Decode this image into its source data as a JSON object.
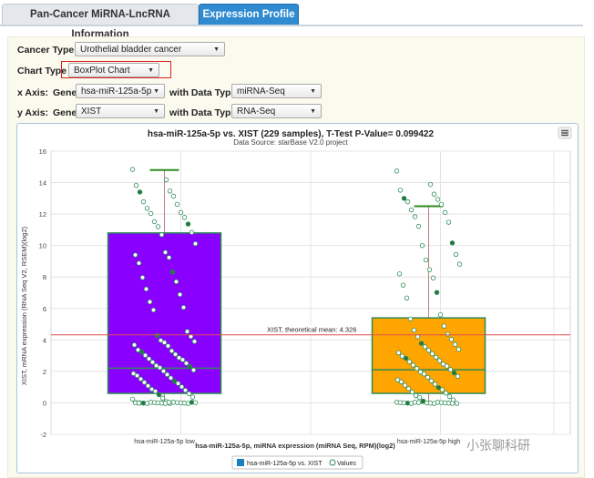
{
  "tabs": [
    {
      "label": "Pan-Cancer MiRNA-LncRNA Information"
    },
    {
      "label": "Expression Profile"
    }
  ],
  "form": {
    "cancer_type_label": "Cancer Type",
    "cancer_type_value": "Urothelial bladder cancer",
    "chart_type_label": "Chart Type",
    "chart_type_value": "BoxPlot Chart",
    "x_axis_label": "x Axis:",
    "y_axis_label": "y Axis:",
    "gene_label": "Gene",
    "with_data_type_label": "with Data Type",
    "x_gene_value": "hsa-miR-125a-5p",
    "x_data_type_value": "miRNA-Seq",
    "y_gene_value": "XIST",
    "y_data_type_value": "RNA-Seq"
  },
  "chart": {
    "menu_icon": "hamburger-icon",
    "watermark": "小张聊科研"
  },
  "colors": {
    "box_low": "#8a00ff",
    "box_high": "#ffa500",
    "whisker": "#2e8b1f",
    "mean_line": "#e05050",
    "tab_active": "#2f8ad0"
  },
  "chart_data": {
    "type": "boxplot",
    "title": "hsa-miR-125a-5p vs. XIST (229 samples), T-Test P-Value= 0.099422",
    "subtitle": "Data Source: starBase V2.0 project",
    "xlabel": "hsa-miR-125a-5p, miRNA expression (miRNA Seq, RPM)(log2)",
    "ylabel": "XIST, mRNA expression (RNA Seq V2, RSEM)(log2)",
    "ylim": [
      -2,
      16
    ],
    "yticks": [
      -2,
      0,
      2,
      4,
      6,
      8,
      10,
      12,
      14,
      16
    ],
    "categories": [
      "hsa-miR-125a-5p low",
      "hsa-miR-125a-5p high"
    ],
    "boxes": [
      {
        "category": "hsa-miR-125a-5p low",
        "whisker_low": 0,
        "q1": 0.6,
        "median": 2.2,
        "q3": 10.8,
        "whisker_high": 14.8,
        "fill": "#8a00ff"
      },
      {
        "category": "hsa-miR-125a-5p high",
        "whisker_low": 0,
        "q1": 0.6,
        "median": 2.1,
        "q3": 5.4,
        "whisker_high": 12.5,
        "fill": "#ffa500"
      }
    ],
    "mean_line": {
      "label": "XIST, theoretical mean: 4.326",
      "value": 4.326
    },
    "legend": [
      {
        "name": "hsa-miR-125a-5p vs. XIST",
        "color": "#1a7fc1"
      },
      {
        "name": "Values",
        "color": "#2e8b57"
      }
    ],
    "legend_position": "bottom",
    "grid": true,
    "points": {
      "low": [
        14.8,
        14.2,
        13.8,
        13.5,
        13.4,
        13.1,
        12.8,
        12.6,
        12.4,
        12.1,
        12.0,
        11.8,
        11.5,
        11.4,
        11.2,
        10.8,
        10.7,
        10.1,
        9.6,
        9.4,
        9.2,
        8.9,
        8.3,
        8.0,
        7.7,
        7.2,
        6.9,
        6.4,
        6.1,
        5.9,
        4.5,
        4.3,
        4.2,
        4.0,
        3.9,
        3.8,
        3.7,
        3.6,
        3.4,
        3.3,
        3.2,
        3.1,
        3.0,
        2.9,
        2.8,
        2.7,
        2.6,
        2.5,
        2.4,
        2.3,
        2.2,
        2.1,
        2.0,
        1.9,
        1.8,
        1.7,
        1.6,
        1.5,
        1.4,
        1.3,
        1.2,
        1.1,
        1.0,
        0.9,
        0.8,
        0.7,
        0.6,
        0.5,
        0.4,
        0.3,
        0.2,
        0.1,
        0,
        0,
        0,
        0,
        0,
        0,
        0,
        0,
        0,
        0,
        0,
        0,
        0,
        0,
        0,
        0,
        0,
        0,
        0,
        0
      ],
      "high": [
        14.7,
        13.9,
        13.5,
        13.3,
        13.0,
        12.9,
        12.8,
        12.6,
        12.3,
        12.1,
        11.8,
        11.5,
        11.2,
        10.2,
        10.0,
        9.4,
        9.1,
        8.8,
        8.5,
        8.2,
        7.9,
        7.5,
        7.0,
        6.7,
        5.6,
        5.3,
        4.9,
        4.6,
        4.4,
        4.2,
        4.0,
        3.8,
        3.7,
        3.6,
        3.4,
        3.3,
        3.2,
        3.1,
        3.0,
        2.9,
        2.8,
        2.7,
        2.6,
        2.5,
        2.4,
        2.3,
        2.2,
        2.1,
        2.0,
        1.9,
        1.8,
        1.7,
        1.6,
        1.5,
        1.4,
        1.3,
        1.2,
        1.1,
        1.0,
        0.9,
        0.8,
        0.7,
        0.6,
        0.5,
        0.4,
        0.3,
        0.2,
        0.1,
        0,
        0,
        0,
        0,
        0,
        0,
        0,
        0,
        0,
        0,
        0,
        0,
        0,
        0,
        0,
        0
      ]
    }
  }
}
